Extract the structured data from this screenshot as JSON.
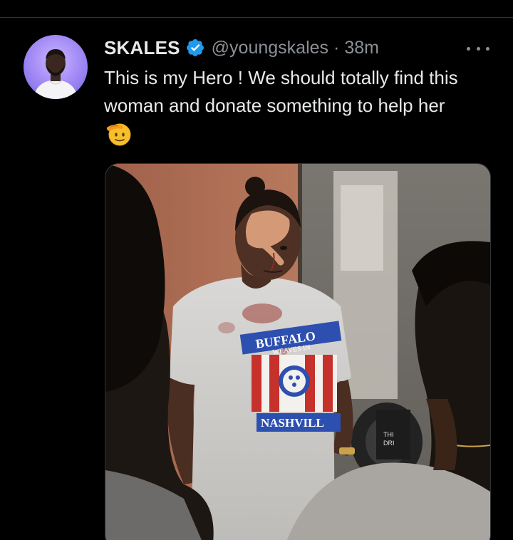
{
  "tweet": {
    "display_name": "SKALES",
    "handle": "@youngskales",
    "separator": "·",
    "timestamp": "38m",
    "text": "This is my Hero ! We should totally find this woman and donate something to help her",
    "emoji": "saluting-face",
    "verified": true
  },
  "media": {
    "shirt_text_top": "BUFFALO",
    "shirt_text_mid": "WEAVES IN",
    "shirt_text_bottom": "NASHVILL",
    "bin_text_1": "THI",
    "bin_text_2": "DRI"
  },
  "colors": {
    "background": "#000000",
    "text_primary": "#e7e9ea",
    "text_secondary": "#8b9096",
    "verified_blue": "#1d9bf0",
    "avatar_bg": "#9d86f4",
    "divider": "#2f3336"
  }
}
